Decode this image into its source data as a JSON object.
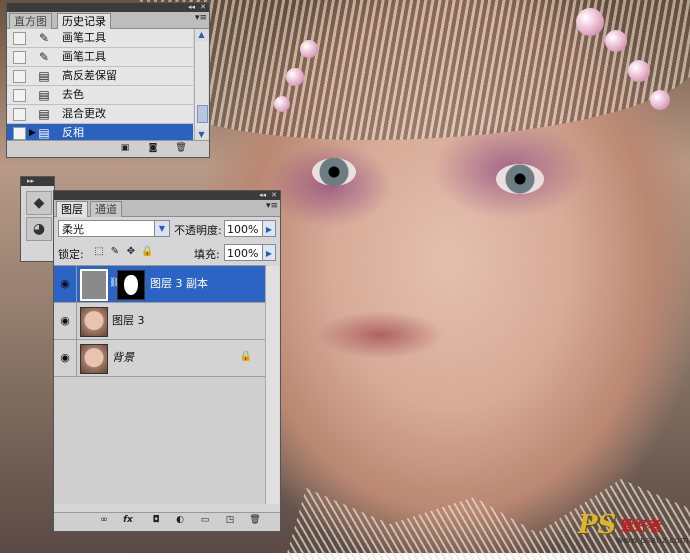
{
  "history_panel": {
    "tabs": [
      {
        "label": "直方图",
        "active": false
      },
      {
        "label": "历史记录",
        "active": true
      }
    ],
    "items": [
      {
        "label": "画笔工具",
        "icon": "brush-icon",
        "selected": false
      },
      {
        "label": "画笔工具",
        "icon": "brush-icon",
        "selected": false
      },
      {
        "label": "高反差保留",
        "icon": "document-step-icon",
        "selected": false
      },
      {
        "label": "去色",
        "icon": "document-step-icon",
        "selected": false
      },
      {
        "label": "混合更改",
        "icon": "document-step-icon",
        "selected": false
      },
      {
        "label": "反相",
        "icon": "document-step-icon",
        "selected": true
      }
    ]
  },
  "layers_panel": {
    "tabs": [
      {
        "label": "图层",
        "active": true
      },
      {
        "label": "通道",
        "active": false
      }
    ],
    "blend_mode": "柔光",
    "opacity_label": "不透明度:",
    "opacity_value": "100%",
    "lock_label": "锁定:",
    "fill_label": "填充:",
    "fill_value": "100%",
    "layers": [
      {
        "name": "图层 3 副本",
        "visible": true,
        "selected": true,
        "has_mask": true,
        "locked": false
      },
      {
        "name": "图层 3",
        "visible": true,
        "selected": false,
        "has_mask": false,
        "locked": false
      },
      {
        "name": "背景",
        "visible": true,
        "selected": false,
        "has_mask": false,
        "locked": true
      }
    ],
    "bottom_buttons": [
      "link-layers-icon",
      "fx-icon",
      "add-mask-icon",
      "adjustment-layer-icon",
      "new-group-icon",
      "new-layer-icon",
      "delete-icon"
    ]
  },
  "watermark": {
    "brand": "PS",
    "cn_text": "爱好者",
    "url": "www.psahz.com"
  },
  "colors": {
    "selection": "#2c64c6",
    "panel_bg": "#d6d6d6",
    "titlebar": "#3b3b3b"
  }
}
